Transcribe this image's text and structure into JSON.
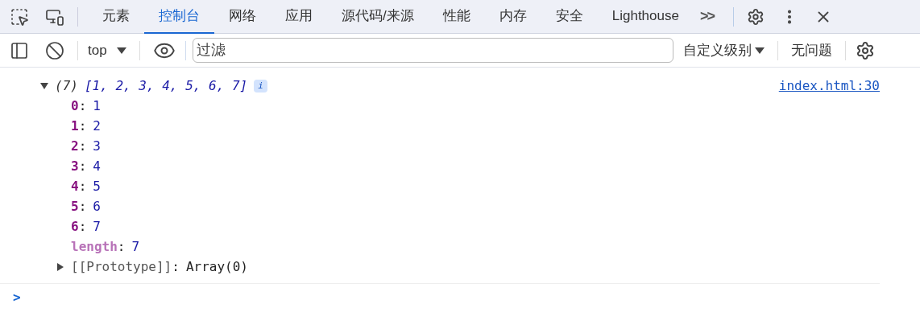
{
  "tabs": [
    {
      "label": "元素",
      "selected": false
    },
    {
      "label": "控制台",
      "selected": true
    },
    {
      "label": "网络",
      "selected": false
    },
    {
      "label": "应用",
      "selected": false
    },
    {
      "label": "源代码/来源",
      "selected": false
    },
    {
      "label": "性能",
      "selected": false
    },
    {
      "label": "内存",
      "selected": false
    },
    {
      "label": "安全",
      "selected": false
    },
    {
      "label": "Lighthouse",
      "selected": false
    }
  ],
  "more_tabs": ">>",
  "toolbar": {
    "context": "top",
    "filter": {
      "placeholder": "过滤"
    },
    "levels": "自定义级别",
    "issues": "无问题"
  },
  "console": {
    "entry": {
      "expanded": true,
      "count": "(7)",
      "preview": "[1, 2, 3, 4, 5, 6, 7]",
      "info": "i",
      "source": "index.html:30",
      "separator": ":",
      "properties": [
        {
          "kind": "index",
          "key": "0",
          "value": "1"
        },
        {
          "kind": "index",
          "key": "1",
          "value": "2"
        },
        {
          "kind": "index",
          "key": "2",
          "value": "3"
        },
        {
          "kind": "index",
          "key": "3",
          "value": "4"
        },
        {
          "kind": "index",
          "key": "4",
          "value": "5"
        },
        {
          "kind": "index",
          "key": "5",
          "value": "6"
        },
        {
          "kind": "index",
          "key": "6",
          "value": "7"
        },
        {
          "kind": "length",
          "key": "length",
          "value": "7"
        },
        {
          "kind": "prototype",
          "key": "[[Prototype]]",
          "value": "Array(0)",
          "expanded": false
        }
      ]
    },
    "prompt": ">"
  }
}
